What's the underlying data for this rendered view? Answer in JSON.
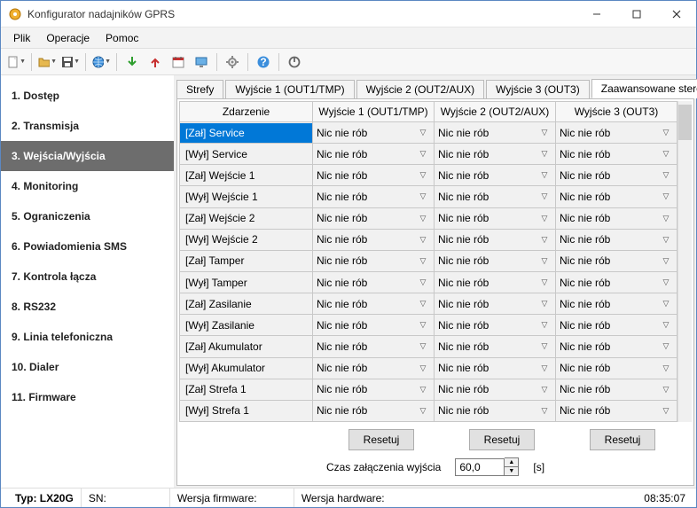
{
  "window": {
    "title": "Konfigurator nadajników GPRS"
  },
  "menu": {
    "file": "Plik",
    "ops": "Operacje",
    "help": "Pomoc"
  },
  "sidebar": {
    "items": [
      {
        "label": "1. Dostęp"
      },
      {
        "label": "2. Transmisja"
      },
      {
        "label": "3. Wejścia/Wyjścia",
        "selected": true
      },
      {
        "label": "4. Monitoring"
      },
      {
        "label": "5. Ograniczenia"
      },
      {
        "label": "6. Powiadomienia SMS"
      },
      {
        "label": "7. Kontrola łącza"
      },
      {
        "label": "8. RS232"
      },
      {
        "label": "9. Linia telefoniczna"
      },
      {
        "label": "10. Dialer"
      },
      {
        "label": "11. Firmware"
      }
    ]
  },
  "tabs": {
    "items": [
      {
        "label": "Strefy"
      },
      {
        "label": "Wyjście 1 (OUT1/TMP)"
      },
      {
        "label": "Wyjście 2 (OUT2/AUX)"
      },
      {
        "label": "Wyjście 3 (OUT3)"
      },
      {
        "label": "Zaawansowane sterowanie wyjściami",
        "selected": true
      }
    ]
  },
  "grid": {
    "headers": {
      "event": "Zdarzenie",
      "out1": "Wyjście 1 (OUT1/TMP)",
      "out2": "Wyjście 2 (OUT2/AUX)",
      "out3": "Wyjście 3 (OUT3)"
    },
    "default_action": "Nic nie rób",
    "rows": [
      {
        "event": "[Zał] Service",
        "selected": true
      },
      {
        "event": "[Wył] Service"
      },
      {
        "event": "[Zał] Wejście 1"
      },
      {
        "event": "[Wył] Wejście 1"
      },
      {
        "event": "[Zał] Wejście 2"
      },
      {
        "event": "[Wył] Wejście 2"
      },
      {
        "event": "[Zał] Tamper"
      },
      {
        "event": "[Wył] Tamper"
      },
      {
        "event": "[Zał] Zasilanie"
      },
      {
        "event": "[Wył] Zasilanie"
      },
      {
        "event": "[Zał] Akumulator"
      },
      {
        "event": "[Wył] Akumulator"
      },
      {
        "event": "[Zał] Strefa 1"
      },
      {
        "event": "[Wył] Strefa 1"
      }
    ]
  },
  "buttons": {
    "reset": "Resetuj"
  },
  "time": {
    "label": "Czas załączenia wyjścia",
    "value": "60,0",
    "unit": "[s]"
  },
  "status": {
    "type_label": "Typ:",
    "type_value": "LX20G",
    "sn_label": "SN:",
    "fw_label": "Wersja firmware:",
    "hw_label": "Wersja hardware:",
    "clock": "08:35:07"
  },
  "colors": {
    "selection_bg": "#0178d7",
    "sidebar_sel": "#6d6d6d"
  }
}
